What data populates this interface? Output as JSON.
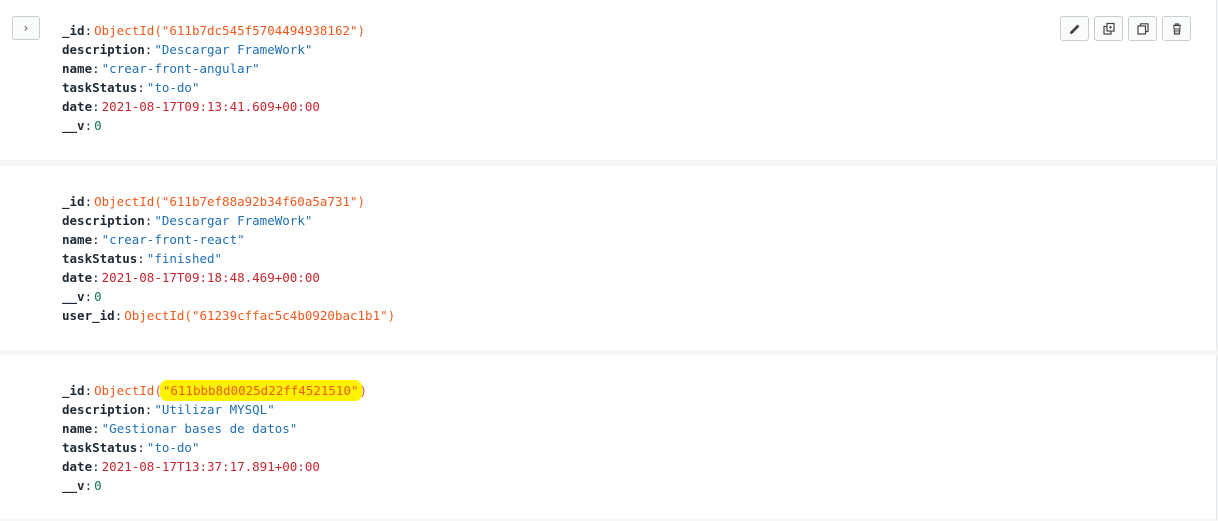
{
  "documents": [
    {
      "fields": [
        {
          "key": "_id",
          "type": "oid",
          "prefix": "ObjectId(\"",
          "value": "611b7dc545f5704494938162",
          "suffix": "\")"
        },
        {
          "key": "description",
          "type": "str",
          "value": "\"Descargar FrameWork\""
        },
        {
          "key": "name",
          "type": "str",
          "value": "\"crear-front-angular\""
        },
        {
          "key": "taskStatus",
          "type": "str",
          "value": "\"to-do\""
        },
        {
          "key": "date",
          "type": "date",
          "value": "2021-08-17T09:13:41.609+00:00"
        },
        {
          "key": "__v",
          "type": "num",
          "value": "0"
        }
      ]
    },
    {
      "fields": [
        {
          "key": "_id",
          "type": "oid",
          "prefix": "ObjectId(\"",
          "value": "611b7ef88a92b34f60a5a731",
          "suffix": "\")"
        },
        {
          "key": "description",
          "type": "str",
          "value": "\"Descargar FrameWork\""
        },
        {
          "key": "name",
          "type": "str",
          "value": "\"crear-front-react\""
        },
        {
          "key": "taskStatus",
          "type": "str",
          "value": "\"finished\""
        },
        {
          "key": "date",
          "type": "date",
          "value": "2021-08-17T09:18:48.469+00:00"
        },
        {
          "key": "__v",
          "type": "num",
          "value": "0"
        },
        {
          "key": "user_id",
          "type": "oid",
          "prefix": "ObjectId(\"",
          "value": "61239cffac5c4b0920bac1b1",
          "suffix": "\")"
        }
      ]
    },
    {
      "fields": [
        {
          "key": "_id",
          "type": "oid",
          "prefix": "ObjectId(",
          "value": "\"611bbb8d0025d22ff4521510\"",
          "suffix": ")",
          "highlighted": true
        },
        {
          "key": "description",
          "type": "str",
          "value": "\"Utilizar MYSQL\""
        },
        {
          "key": "name",
          "type": "str",
          "value": "\"Gestionar bases de datos\""
        },
        {
          "key": "taskStatus",
          "type": "str",
          "value": "\"to-do\""
        },
        {
          "key": "date",
          "type": "date",
          "value": "2021-08-17T13:37:17.891+00:00"
        },
        {
          "key": "__v",
          "type": "num",
          "value": "0"
        }
      ]
    }
  ],
  "toolbar": {
    "icons": [
      "pencil-icon",
      "clone-icon",
      "copy-icon",
      "trash-icon"
    ]
  },
  "expand": {
    "icon": "chevron-right-icon",
    "glyph": "›"
  },
  "colors": {
    "string": "#1f6fb2",
    "date": "#c4262e",
    "number": "#0d7a55",
    "objectid": "#ef5a1c",
    "highlight": "#fff200"
  }
}
